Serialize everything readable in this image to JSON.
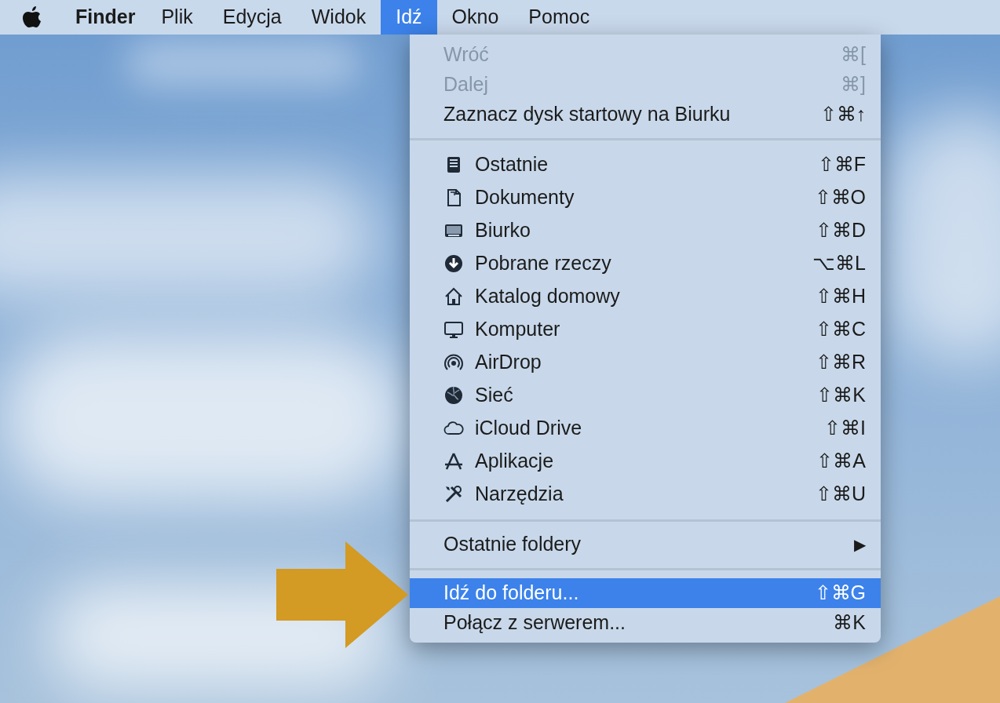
{
  "menubar": {
    "app_name": "Finder",
    "menus": [
      {
        "label": "Plik",
        "selected": false
      },
      {
        "label": "Edycja",
        "selected": false
      },
      {
        "label": "Widok",
        "selected": false
      },
      {
        "label": "Idź",
        "selected": true
      },
      {
        "label": "Okno",
        "selected": false
      },
      {
        "label": "Pomoc",
        "selected": false
      }
    ]
  },
  "menu": {
    "sections": [
      {
        "items": [
          {
            "kind": "plain",
            "label": "Wróć",
            "shortcut": "⌘[",
            "disabled": true,
            "selected": false
          },
          {
            "kind": "plain",
            "label": "Dalej",
            "shortcut": "⌘]",
            "disabled": true,
            "selected": false
          },
          {
            "kind": "plain",
            "label": "Zaznacz dysk startowy na Biurku",
            "shortcut": "⇧⌘↑",
            "disabled": false,
            "selected": false
          }
        ]
      },
      {
        "items": [
          {
            "kind": "icon",
            "label": "Ostatnie",
            "shortcut": "⇧⌘F",
            "disabled": false,
            "selected": false
          },
          {
            "kind": "icon",
            "label": "Dokumenty",
            "shortcut": "⇧⌘O",
            "disabled": false,
            "selected": false
          },
          {
            "kind": "icon",
            "label": "Biurko",
            "shortcut": "⇧⌘D",
            "disabled": false,
            "selected": false
          },
          {
            "kind": "icon",
            "label": "Pobrane rzeczy",
            "shortcut": "⌥⌘L",
            "disabled": false,
            "selected": false
          },
          {
            "kind": "icon",
            "label": "Katalog domowy",
            "shortcut": "⇧⌘H",
            "disabled": false,
            "selected": false
          },
          {
            "kind": "icon",
            "label": "Komputer",
            "shortcut": "⇧⌘C",
            "disabled": false,
            "selected": false
          },
          {
            "kind": "icon",
            "label": "AirDrop",
            "shortcut": "⇧⌘R",
            "disabled": false,
            "selected": false
          },
          {
            "kind": "icon",
            "label": "Sieć",
            "shortcut": "⇧⌘K",
            "disabled": false,
            "selected": false
          },
          {
            "kind": "icon",
            "label": "iCloud Drive",
            "shortcut": "⇧⌘I",
            "disabled": false,
            "selected": false
          },
          {
            "kind": "icon",
            "label": "Aplikacje",
            "shortcut": "⇧⌘A",
            "disabled": false,
            "selected": false
          },
          {
            "kind": "icon",
            "label": "Narzędzia",
            "shortcut": "⇧⌘U",
            "disabled": false,
            "selected": false
          }
        ]
      },
      {
        "items": [
          {
            "kind": "submenu",
            "label": "Ostatnie foldery",
            "shortcut": "▶",
            "disabled": false,
            "selected": false
          }
        ]
      },
      {
        "items": [
          {
            "kind": "plain",
            "label": "Idź do folderu...",
            "shortcut": "⇧⌘G",
            "disabled": false,
            "selected": true
          },
          {
            "kind": "plain",
            "label": "Połącz z serwerem...",
            "shortcut": "⌘K",
            "disabled": false,
            "selected": false
          }
        ]
      }
    ]
  }
}
